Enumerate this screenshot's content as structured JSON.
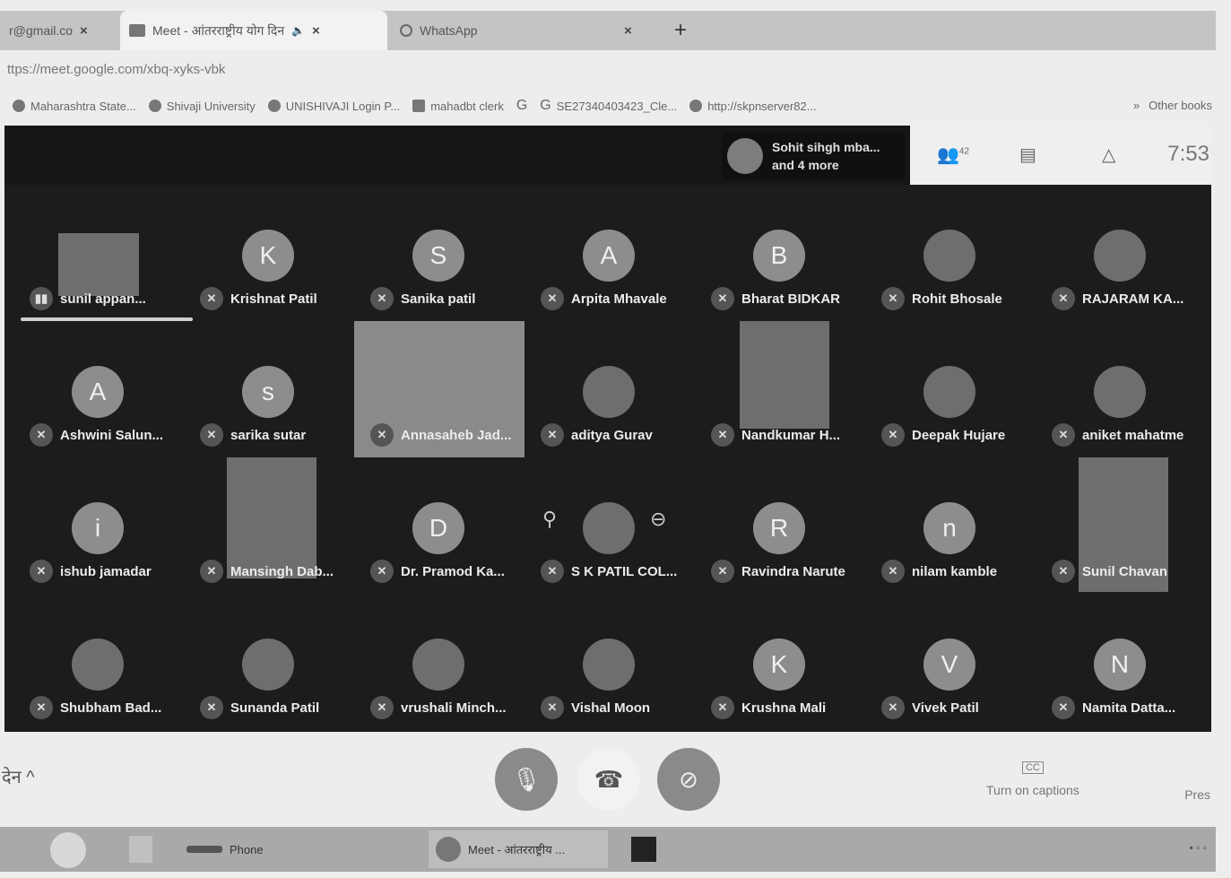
{
  "tabs": [
    {
      "label": "r@gmail.co",
      "close": "×"
    },
    {
      "label": "Meet - आंतरराष्ट्रीय योग दिन",
      "sound": "🔈",
      "close": "×"
    },
    {
      "label": "WhatsApp",
      "close": "×"
    }
  ],
  "new_tab": "+",
  "url": "ttps://meet.google.com/xbq-xyks-vbk",
  "bookmarks": [
    {
      "label": "Maharashtra State..."
    },
    {
      "label": "Shivaji University"
    },
    {
      "label": "UNISHIVAJI Login P..."
    },
    {
      "label": "mahadbt clerk"
    },
    {
      "label": "G"
    },
    {
      "label": "SE27340403423_Cle..."
    },
    {
      "label": "http://skpnserver82..."
    }
  ],
  "bookmarks_more": "»",
  "other_bookmarks": "Other books",
  "presenter": {
    "line1": "Sohit sihgh mba...",
    "line2": "and 4 more"
  },
  "participant_count": "42",
  "clock": "7:53",
  "participants": [
    {
      "name": "sunil appan...",
      "initial": "",
      "kind": "video",
      "speaking": true
    },
    {
      "name": "Krishnat Patil",
      "initial": "K",
      "kind": "avatar"
    },
    {
      "name": "Sanika patil",
      "initial": "S",
      "kind": "avatar"
    },
    {
      "name": "Arpita Mhavale",
      "initial": "A",
      "kind": "avatar"
    },
    {
      "name": "Bharat BIDKAR",
      "initial": "B",
      "kind": "avatar"
    },
    {
      "name": "Rohit Bhosale",
      "initial": "",
      "kind": "photo"
    },
    {
      "name": "RAJARAM KA...",
      "initial": "",
      "kind": "photo"
    },
    {
      "name": "Ashwini Salun...",
      "initial": "A",
      "kind": "avatar"
    },
    {
      "name": "sarika sutar",
      "initial": "s",
      "kind": "avatar"
    },
    {
      "name": "Annasaheb Jad...",
      "initial": "",
      "kind": "bigvideo"
    },
    {
      "name": "aditya Gurav",
      "initial": "",
      "kind": "photo"
    },
    {
      "name": "Nandkumar H...",
      "initial": "",
      "kind": "video"
    },
    {
      "name": "Deepak Hujare",
      "initial": "",
      "kind": "photo"
    },
    {
      "name": "aniket mahatme",
      "initial": "",
      "kind": "photo"
    },
    {
      "name": "ishub jamadar",
      "initial": "i",
      "kind": "avatar"
    },
    {
      "name": "Mansingh Dab...",
      "initial": "",
      "kind": "video"
    },
    {
      "name": "Dr. Pramod Ka...",
      "initial": "D",
      "kind": "avatar"
    },
    {
      "name": "S K PATIL COL...",
      "initial": "",
      "kind": "photo-hover"
    },
    {
      "name": "Ravindra Narute",
      "initial": "R",
      "kind": "avatar"
    },
    {
      "name": "nilam kamble",
      "initial": "n",
      "kind": "avatar"
    },
    {
      "name": "Sunil Chavan",
      "initial": "",
      "kind": "tallvideo"
    },
    {
      "name": "Shubham Bad...",
      "initial": "",
      "kind": "photo"
    },
    {
      "name": "Sunanda Patil",
      "initial": "",
      "kind": "photo"
    },
    {
      "name": "vrushali Minch...",
      "initial": "",
      "kind": "photo"
    },
    {
      "name": "Vishal Moon",
      "initial": "",
      "kind": "photo"
    },
    {
      "name": "Krushna Mali",
      "initial": "K",
      "kind": "avatar"
    },
    {
      "name": "Vivek Patil",
      "initial": "V",
      "kind": "avatar"
    },
    {
      "name": "Namita Datta...",
      "initial": "N",
      "kind": "avatar"
    }
  ],
  "bottom": {
    "meeting_details": "देन  ^",
    "captions_label": "Turn on captions",
    "captions_icon": "CC",
    "present_label": "Pres"
  },
  "taskbar": [
    {
      "label": "Phone"
    },
    {
      "label": "Meet - आंतरराष्ट्रीय ..."
    }
  ],
  "icons": {
    "mic_off": "mic-off-icon",
    "people": "people-icon",
    "chat": "chat-icon",
    "activities": "activities-icon",
    "end_call": "end-call-icon",
    "camera_off": "camera-off-icon"
  }
}
